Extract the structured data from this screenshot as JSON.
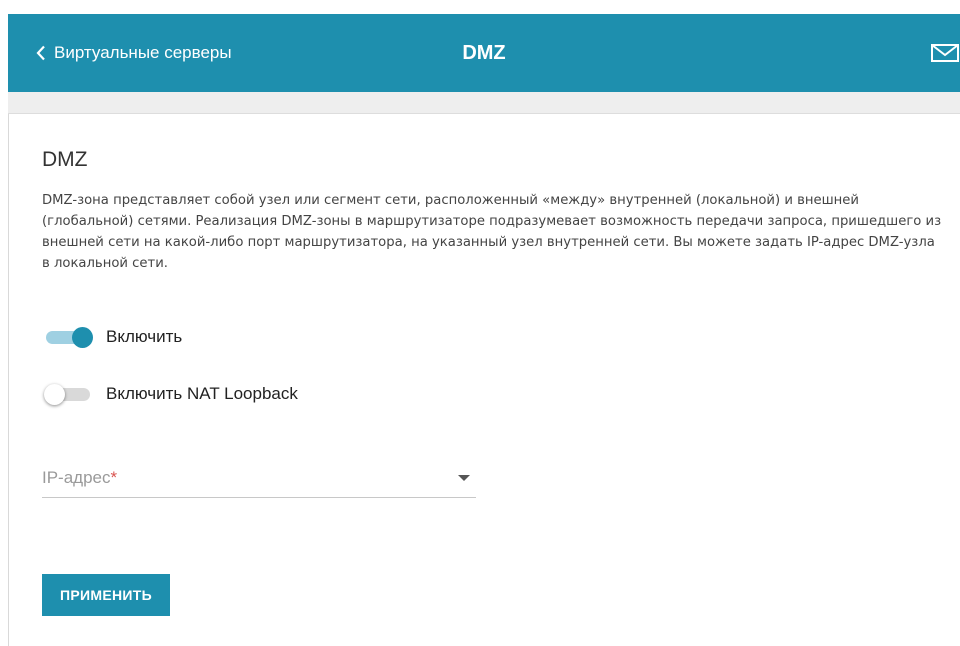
{
  "header": {
    "back_label": "Виртуальные серверы",
    "title": "DMZ",
    "mail_icon": "mail-icon",
    "color": "#1e8fae"
  },
  "main": {
    "section_title": "DMZ",
    "description": "DMZ-зона представляет собой узел или сегмент сети, расположенный «между» внутренней (локальной) и внешней (глобальной) сетями. Реализация DMZ-зоны в маршрутизаторе подразумевает возможность передачи запроса, пришедшего из внешней сети на какой-либо порт маршрутизатора, на указанный узел внутренней сети. Вы можете задать IP-адрес DMZ-узла в локальной сети.",
    "toggles": [
      {
        "label": "Включить",
        "checked": true
      },
      {
        "label": "Включить NAT Loopback",
        "checked": false
      }
    ],
    "ip_field": {
      "label": "IP-адрес",
      "required_mark": "*",
      "value": ""
    },
    "apply_label": "ПРИМЕНИТЬ"
  }
}
